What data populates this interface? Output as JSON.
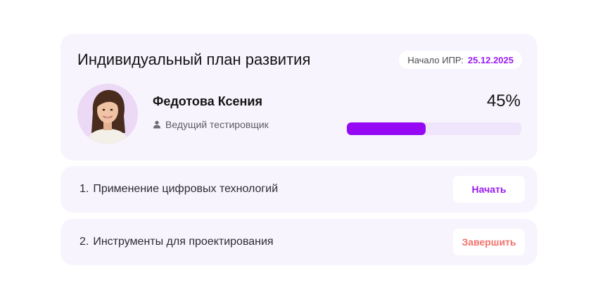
{
  "header": {
    "title": "Индивидуальный план развития",
    "start_label": "Начало ИПР:",
    "start_date": "25.12.2025"
  },
  "employee": {
    "name": "Федотова Ксения",
    "role": "Ведущий тестировщик",
    "role_icon": "user-icon",
    "avatar": "avatar-photo"
  },
  "progress": {
    "label": "45%",
    "fraction": 0.45
  },
  "tasks": [
    {
      "number": "1.",
      "title": "Применение цифровых технологий",
      "action": "Начать",
      "action_color": "#9a1cf2"
    },
    {
      "number": "2.",
      "title": "Инструменты для проектирования",
      "action": "Завершить",
      "action_color": "#f2736b"
    }
  ],
  "colors": {
    "accent": "#9509f4",
    "card_background": "#f8f4fd",
    "progress_track": "#f0e6fb"
  }
}
